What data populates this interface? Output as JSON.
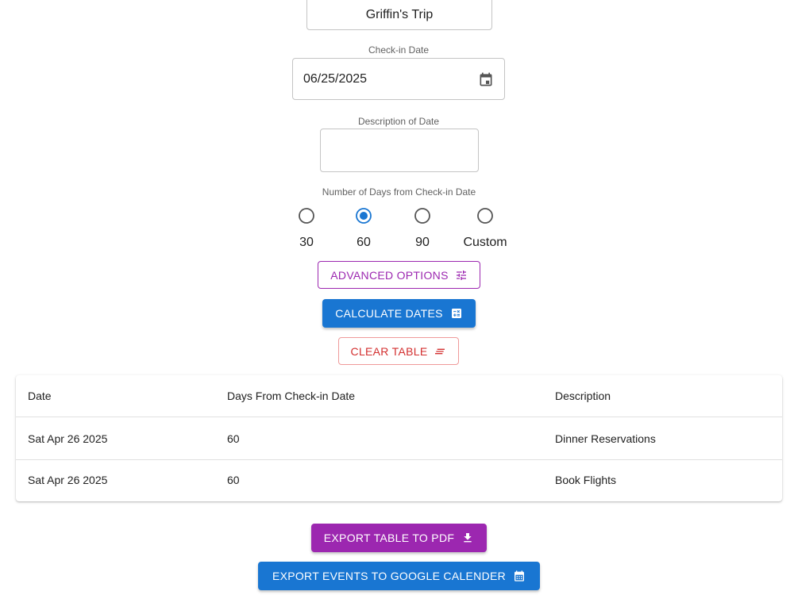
{
  "form": {
    "trip_name": "Griffin's Trip",
    "checkin_label": "Check-in Date",
    "checkin_value": "06/25/2025",
    "description_label": "Description of Date",
    "description_value": "",
    "days_label": "Number of Days from Check-in Date",
    "day_options": [
      {
        "label": "30",
        "selected": false
      },
      {
        "label": "60",
        "selected": true
      },
      {
        "label": "90",
        "selected": false
      },
      {
        "label": "Custom",
        "selected": false
      }
    ]
  },
  "buttons": {
    "advanced": "ADVANCED OPTIONS",
    "calculate": "CALCULATE DATES",
    "clear": "CLEAR TABLE",
    "export_pdf": "EXPORT TABLE TO PDF",
    "export_google": "EXPORT EVENTS TO GOOGLE CALENDER"
  },
  "icons": {
    "checkin": "calendar-icon",
    "advanced": "tune-icon",
    "calculate": "calculator-icon",
    "clear": "clear-all-icon",
    "export_pdf": "download-icon",
    "export_google": "calendar-month-icon"
  },
  "table": {
    "headers": [
      "Date",
      "Days From Check-in Date",
      "Description"
    ],
    "rows": [
      [
        "Sat Apr 26 2025",
        "60",
        "Dinner Reservations"
      ],
      [
        "Sat Apr 26 2025",
        "60",
        "Book Flights"
      ]
    ]
  },
  "colors": {
    "primary": "#1976d2",
    "secondary": "#9c27b0",
    "error": "#d32f2f"
  }
}
